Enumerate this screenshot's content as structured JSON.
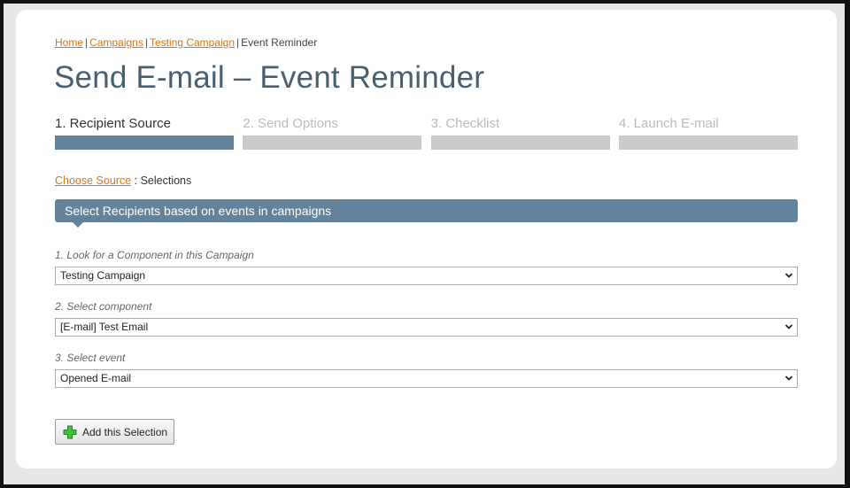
{
  "breadcrumb": {
    "links": [
      "Home",
      "Campaigns",
      "Testing Campaign"
    ],
    "current": "Event Reminder",
    "separator": "|"
  },
  "page_title": "Send E-mail – Event Reminder",
  "steps": [
    {
      "label": "1. Recipient Source",
      "active": true
    },
    {
      "label": "2. Send Options",
      "active": false
    },
    {
      "label": "3. Checklist",
      "active": false
    },
    {
      "label": "4. Launch E-mail",
      "active": false
    }
  ],
  "subcrumb": {
    "link": "Choose Source",
    "text": " : Selections"
  },
  "banner": "Select Recipients based on events in campaigns",
  "fields": [
    {
      "label": "1. Look for a Component in this Campaign",
      "value": "Testing Campaign"
    },
    {
      "label": "2. Select component",
      "value": "[E-mail] Test Email"
    },
    {
      "label": "3. Select event",
      "value": "Opened E-mail"
    }
  ],
  "add_button": {
    "label": "Add this Selection",
    "icon": "plus-icon"
  },
  "colors": {
    "accent": "#62839b",
    "link": "#d2771f",
    "inactive_step": "#cacaca"
  }
}
